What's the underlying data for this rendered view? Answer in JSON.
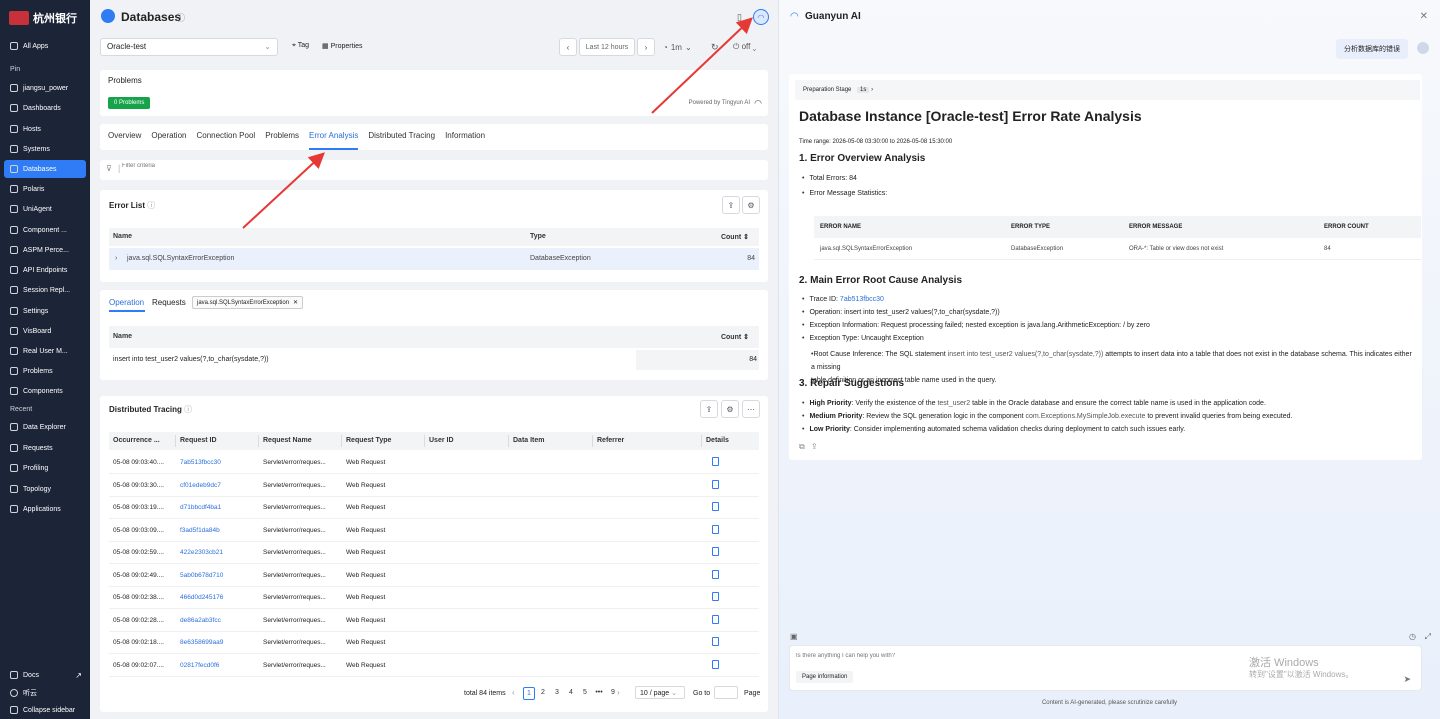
{
  "sidebar": {
    "logo_text": "杭州银行",
    "all_apps": "All Apps",
    "pin_label": "Pin",
    "pin_items": [
      "jiangsu_power",
      "Dashboards",
      "Hosts",
      "Systems",
      "Databases",
      "Polaris",
      "UniAgent",
      "Component ...",
      "ASPM Perce...",
      "API Endpoints",
      "Session Repl...",
      "Settings",
      "VisBoard",
      "Real User M...",
      "Problems",
      "Components"
    ],
    "recent_label": "Recent",
    "recent_items": [
      "Data Explorer",
      "Requests",
      "Profiling",
      "Topology",
      "Applications"
    ],
    "docs": "Docs",
    "user": "听云",
    "collapse": "Collapse sidebar"
  },
  "header": {
    "title": "Databases",
    "instance": "Oracle-test",
    "tag": "Tag",
    "properties": "Properties",
    "time_range": "Last 12 hours",
    "interval": "1m",
    "refresh": "off"
  },
  "problems": {
    "title": "Problems",
    "badge": "0 Problems",
    "powered": "Powered by Tingyun AI"
  },
  "tabs": [
    "Overview",
    "Operation",
    "Connection Pool",
    "Problems",
    "Error Analysis",
    "Distributed Tracing",
    "Information"
  ],
  "filter_placeholder": "Filter criteria",
  "error_list": {
    "title": "Error List",
    "columns": [
      "Name",
      "Type",
      "Count"
    ],
    "rows": [
      {
        "name": "java.sql.SQLSyntaxErrorException",
        "type": "DatabaseException",
        "count": "84"
      }
    ]
  },
  "operation": {
    "tabs": [
      "Operation",
      "Requests"
    ],
    "chip": "java.sql.SQLSyntaxErrorException",
    "columns": [
      "Name",
      "Count"
    ],
    "rows": [
      {
        "name": "insert into test_user2 values(?,to_char(sysdate,?))",
        "count": "84"
      }
    ]
  },
  "tracing": {
    "title": "Distributed Tracing",
    "columns": [
      "Occurrence ...",
      "Request ID",
      "Request Name",
      "Request Type",
      "User ID",
      "Data Item",
      "Referrer",
      "Details"
    ],
    "rows": [
      {
        "time": "05-08 09:03:40....",
        "id": "7ab513fbcc30",
        "name": "Servlet/error/reques...",
        "type": "Web Request"
      },
      {
        "time": "05-08 09:03:30....",
        "id": "cf01edeb9dc7",
        "name": "Servlet/error/reques...",
        "type": "Web Request"
      },
      {
        "time": "05-08 09:03:19....",
        "id": "d71bbcdf4ba1",
        "name": "Servlet/error/reques...",
        "type": "Web Request"
      },
      {
        "time": "05-08 09:03:09....",
        "id": "f3ad5f1da84b",
        "name": "Servlet/error/reques...",
        "type": "Web Request"
      },
      {
        "time": "05-08 09:02:59....",
        "id": "422e2303cb21",
        "name": "Servlet/error/reques...",
        "type": "Web Request"
      },
      {
        "time": "05-08 09:02:49....",
        "id": "5ab0b678d710",
        "name": "Servlet/error/reques...",
        "type": "Web Request"
      },
      {
        "time": "05-08 09:02:38....",
        "id": "466d0d245176",
        "name": "Servlet/error/reques...",
        "type": "Web Request"
      },
      {
        "time": "05-08 09:02:28....",
        "id": "de86a2ab3fcc",
        "name": "Servlet/error/reques...",
        "type": "Web Request"
      },
      {
        "time": "05-08 09:02:18....",
        "id": "8e6358699aa9",
        "name": "Servlet/error/reques...",
        "type": "Web Request"
      },
      {
        "time": "05-08 09:02:07....",
        "id": "02817fecd0f6",
        "name": "Servlet/error/reques...",
        "type": "Web Request"
      }
    ],
    "total": "total 84 items",
    "pages": [
      "1",
      "2",
      "3",
      "4",
      "5",
      "•••",
      "9"
    ],
    "page_size": "10 / page",
    "goto": "Go to",
    "page_suffix": "Page"
  },
  "ai": {
    "title": "Guanyun AI",
    "user_msg": "分析数据库的错误",
    "stage": "Preparation Stage",
    "stage_time": "1s",
    "report_title": "Database Instance [Oracle-test] Error Rate Analysis",
    "time_range": "Time range: 2026-05-08 03:30:00 to 2026-05-08 15:30:00",
    "s1": "1. Error Overview Analysis",
    "total_errors": "Total Errors: 84",
    "msg_stats": "Error Message Statistics:",
    "table_cols": [
      "ERROR NAME",
      "ERROR TYPE",
      "ERROR MESSAGE",
      "ERROR COUNT"
    ],
    "table_row": [
      "java.sql.SQLSyntaxErrorException",
      "DatabaseException",
      "ORA-*: Table or view does not exist",
      "84"
    ],
    "s2": "2. Main Error Root Cause Analysis",
    "trace_label": "Trace ID: ",
    "trace_id": "7ab513fbcc30",
    "operation_line": "Operation: insert into test_user2 values(?,to_char(sysdate,?))",
    "exception_info": "Exception Information: Request processing failed; nested exception is java.lang.ArithmeticException: / by zero",
    "exception_type": "Exception Type: Uncaught Exception",
    "root_a": "Root Cause Inference: The SQL statement ",
    "root_code": "insert into test_user2 values(?,to_char(sysdate,?))",
    "root_b": " attempts to insert data into a table that does not exist in the database schema. This indicates either a missing",
    "root_c": "table definition or an incorrect table name used in the query.",
    "s3": "3. Repair Suggestions",
    "high_label": "High Priority",
    "high_a": ": Verify the existence of the ",
    "high_code": "test_user2",
    "high_b": " table in the Oracle database and ensure the correct table name is used in the application code.",
    "med_label": "Medium Priority",
    "med_a": ": Review the SQL generation logic in the component ",
    "med_code": "com.Exceptions.MySimpleJob.execute",
    "med_b": " to prevent invalid queries from being executed.",
    "low_label": "Low Priority",
    "low_a": ": Consider implementing automated schema validation checks during deployment to catch such issues early.",
    "input_placeholder": "Is there anything I can help you with?",
    "page_info": "Page information",
    "watermark_1": "激活 Windows",
    "watermark_2": "转到\"设置\"以激活 Windows。",
    "footer": "Content is AI-generated, please scrutinize carefully"
  },
  "colors": {
    "accent": "#2f7cf6",
    "badge": "#16a34a",
    "arrow": "#e53935",
    "sidebar": "#1c2438"
  }
}
